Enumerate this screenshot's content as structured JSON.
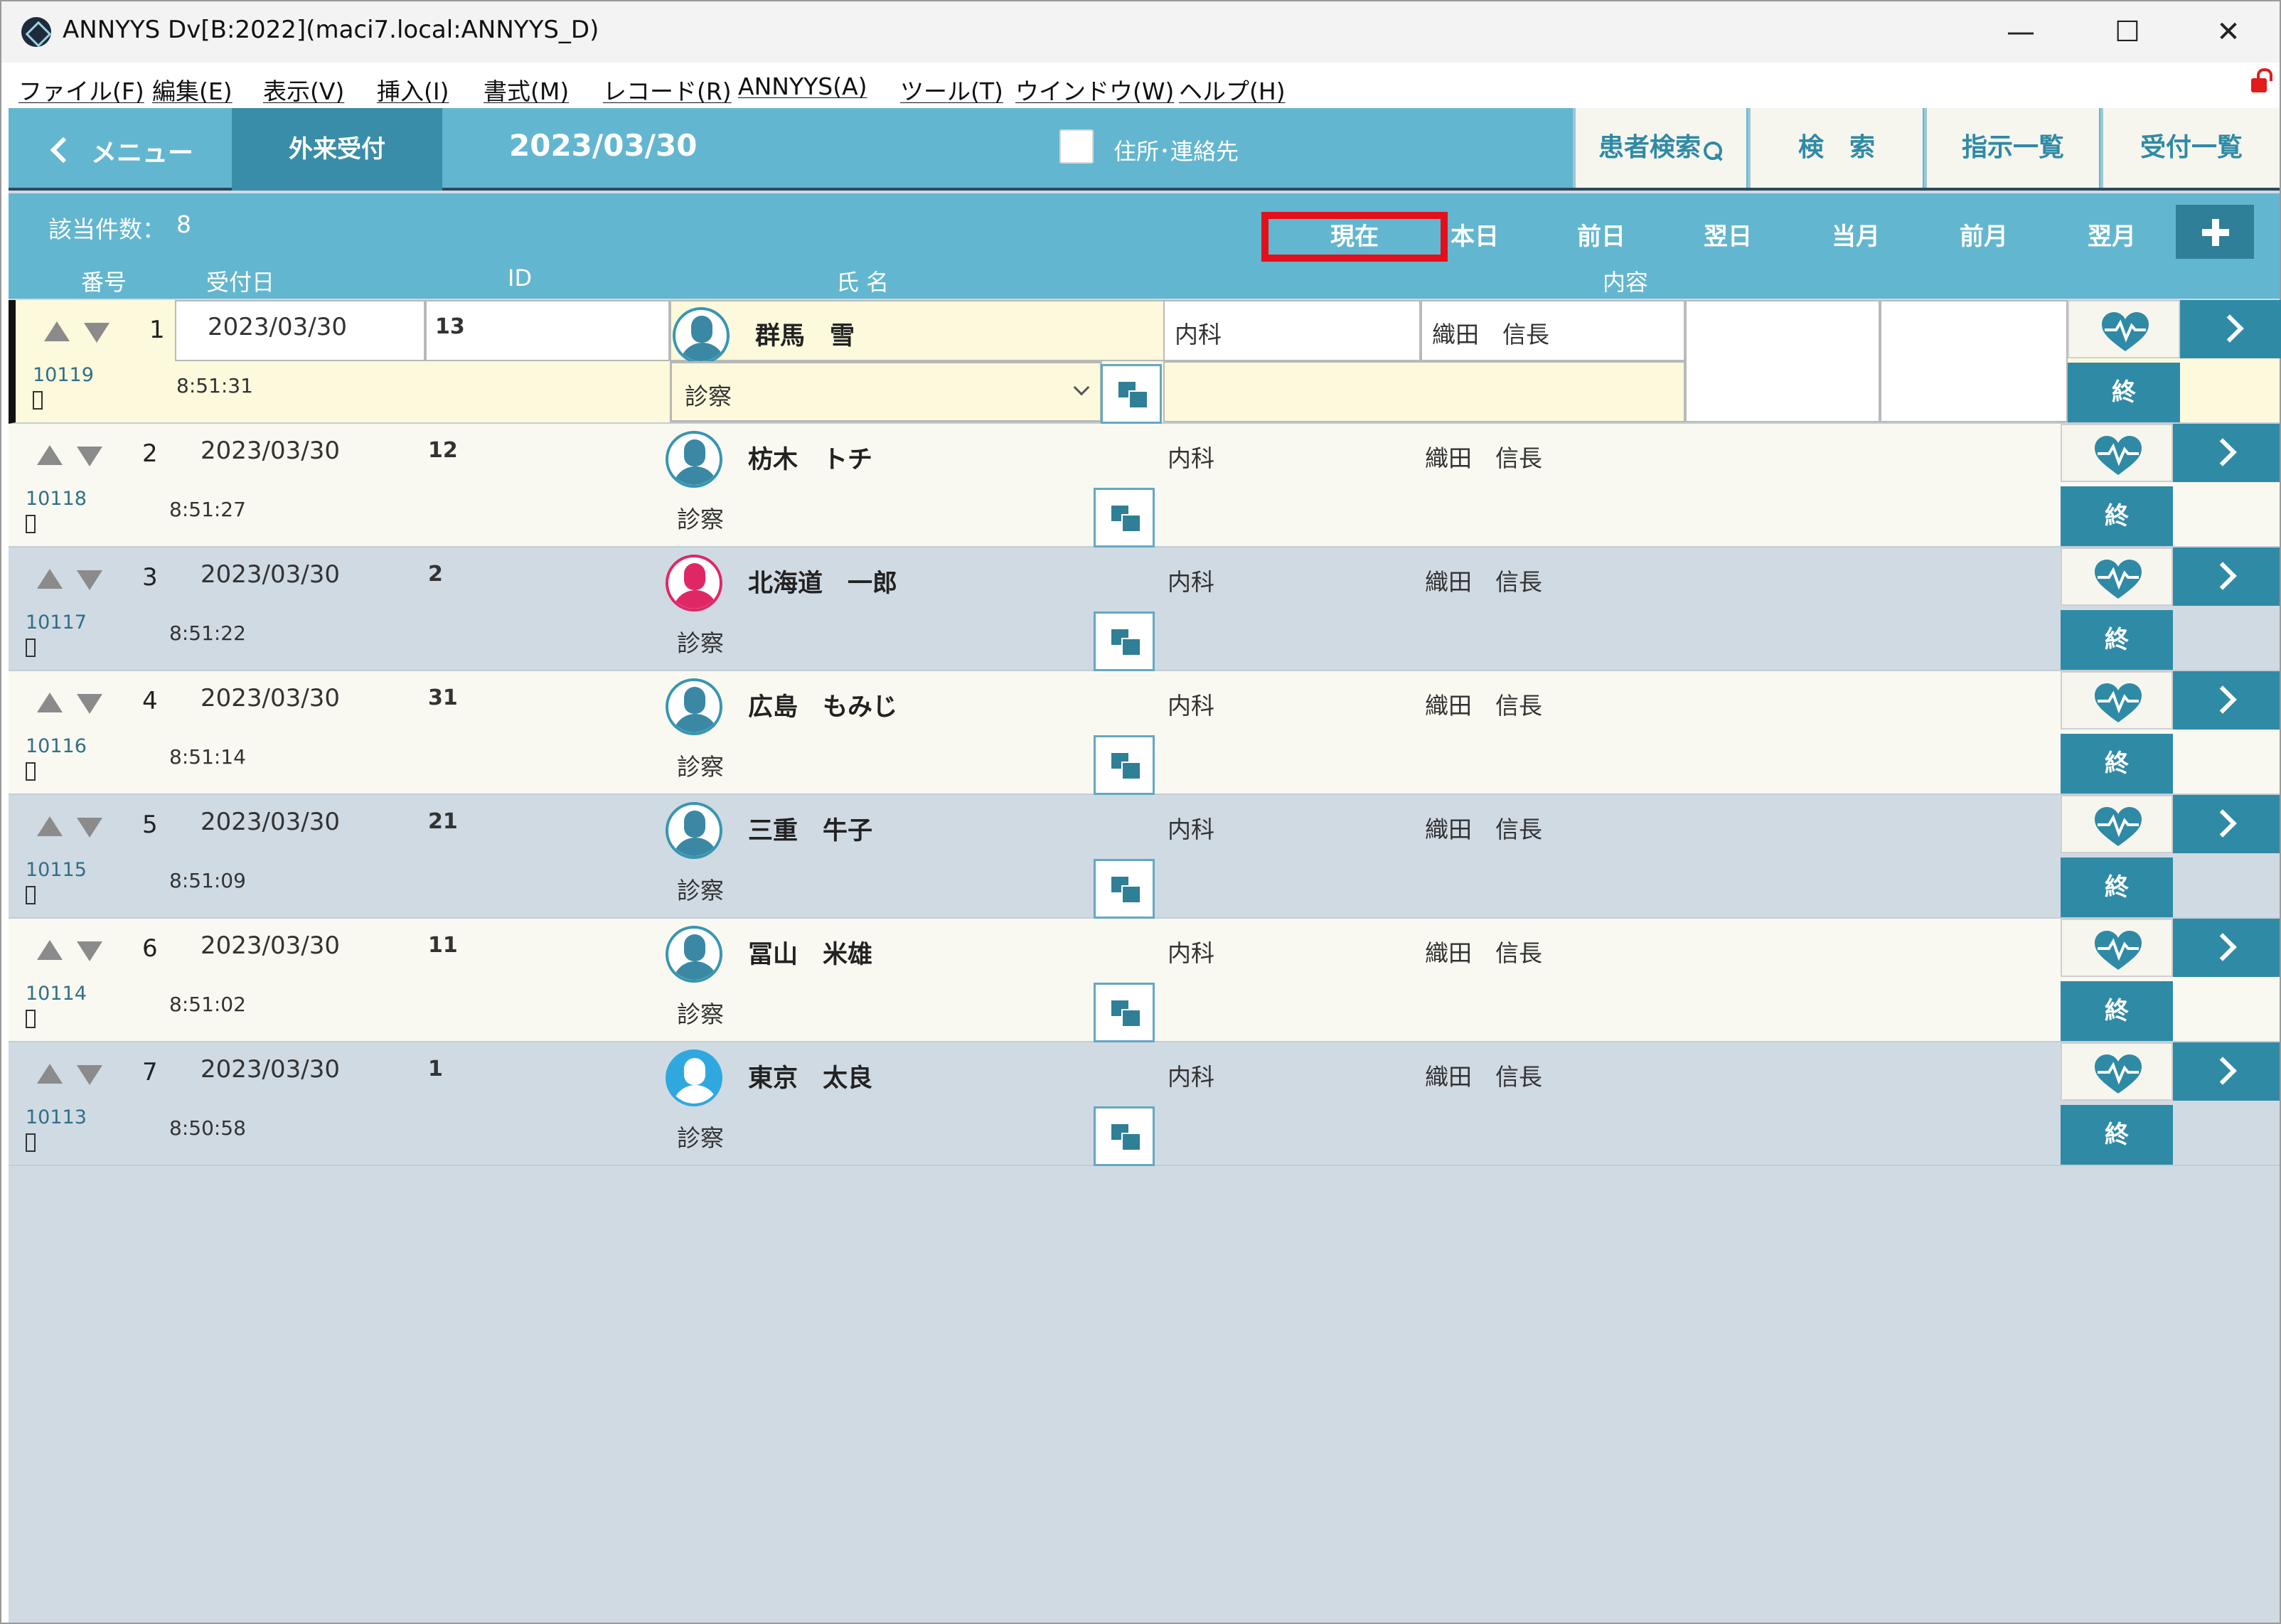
{
  "window": {
    "title": "ANNYYS Dv[B:2022](maci7.local:ANNYYS_D)",
    "minimize": "—",
    "maximize": "☐",
    "close": "✕"
  },
  "menubar": [
    "ファイル(F)",
    "編集(E)",
    "表示(V)",
    "挿入(I)",
    "書式(M)",
    "レコード(R)",
    "ANNYYS(A)",
    "ツール(T)",
    "ウインドウ(W)",
    "ヘルプ(H)"
  ],
  "header": {
    "menu_label": "メニュー",
    "tab_label": "外来受付",
    "date": "2023/03/30",
    "address_checkbox_label": "住所･連絡先",
    "buttons": [
      "患者検索",
      "検　索",
      "指示一覧",
      "受付一覧"
    ]
  },
  "filter": {
    "count_label": "該当件数：",
    "count_value": "8",
    "ranges": [
      "現在",
      "本日",
      "前日",
      "翌日",
      "当月",
      "前月",
      "翌月"
    ],
    "selected_range": "現在"
  },
  "columns": [
    "番号",
    "受付日",
    "ID",
    "氏 名",
    "内容"
  ],
  "rows": [
    {
      "num": "1",
      "rid": "10119",
      "date": "2023/03/30",
      "time": "8:51:31",
      "pid": "13",
      "name": "群馬　雪",
      "visit": "診察",
      "dept": "内科",
      "doctor": "織田　信長",
      "avatar": "blue",
      "selected": true,
      "end": "終"
    },
    {
      "num": "2",
      "rid": "10118",
      "date": "2023/03/30",
      "time": "8:51:27",
      "pid": "12",
      "name": "枋木　トチ",
      "visit": "診察",
      "dept": "内科",
      "doctor": "織田　信長",
      "avatar": "blue",
      "selected": false,
      "end": "終"
    },
    {
      "num": "3",
      "rid": "10117",
      "date": "2023/03/30",
      "time": "8:51:22",
      "pid": "2",
      "name": "北海道　一郎",
      "visit": "診察",
      "dept": "内科",
      "doctor": "織田　信長",
      "avatar": "red",
      "selected": false,
      "end": "終"
    },
    {
      "num": "4",
      "rid": "10116",
      "date": "2023/03/30",
      "time": "8:51:14",
      "pid": "31",
      "name": "広島　もみじ",
      "visit": "診察",
      "dept": "内科",
      "doctor": "織田　信長",
      "avatar": "blue",
      "selected": false,
      "end": "終"
    },
    {
      "num": "5",
      "rid": "10115",
      "date": "2023/03/30",
      "time": "8:51:09",
      "pid": "21",
      "name": "三重　牛子",
      "visit": "診察",
      "dept": "内科",
      "doctor": "織田　信長",
      "avatar": "blue",
      "selected": false,
      "end": "終"
    },
    {
      "num": "6",
      "rid": "10114",
      "date": "2023/03/30",
      "time": "8:51:02",
      "pid": "11",
      "name": "冨山　米雄",
      "visit": "診察",
      "dept": "内科",
      "doctor": "織田　信長",
      "avatar": "blue",
      "selected": false,
      "end": "終"
    },
    {
      "num": "7",
      "rid": "10113",
      "date": "2023/03/30",
      "time": "8:50:58",
      "pid": "1",
      "name": "東京　太良",
      "visit": "診察",
      "dept": "内科",
      "doctor": "織田　信長",
      "avatar": "cyan",
      "selected": false,
      "end": "終"
    }
  ],
  "colors": {
    "header_bg": "#63b6cf",
    "tab_active": "#3a8da8",
    "button_teal": "#2f8aa6",
    "row_light": "#faf9f1",
    "row_dark": "#d0dae3",
    "row_selected": "#fcf9dc",
    "highlight_box": "#e3101b"
  },
  "icons": {
    "back": "chevron-left-icon",
    "search": "magnifier-icon",
    "add": "plus-icon",
    "vital": "heart-pulse-icon",
    "detail": "chevron-right-icon",
    "copy": "copy-icon",
    "lock": "unlocked-padlock-icon"
  }
}
